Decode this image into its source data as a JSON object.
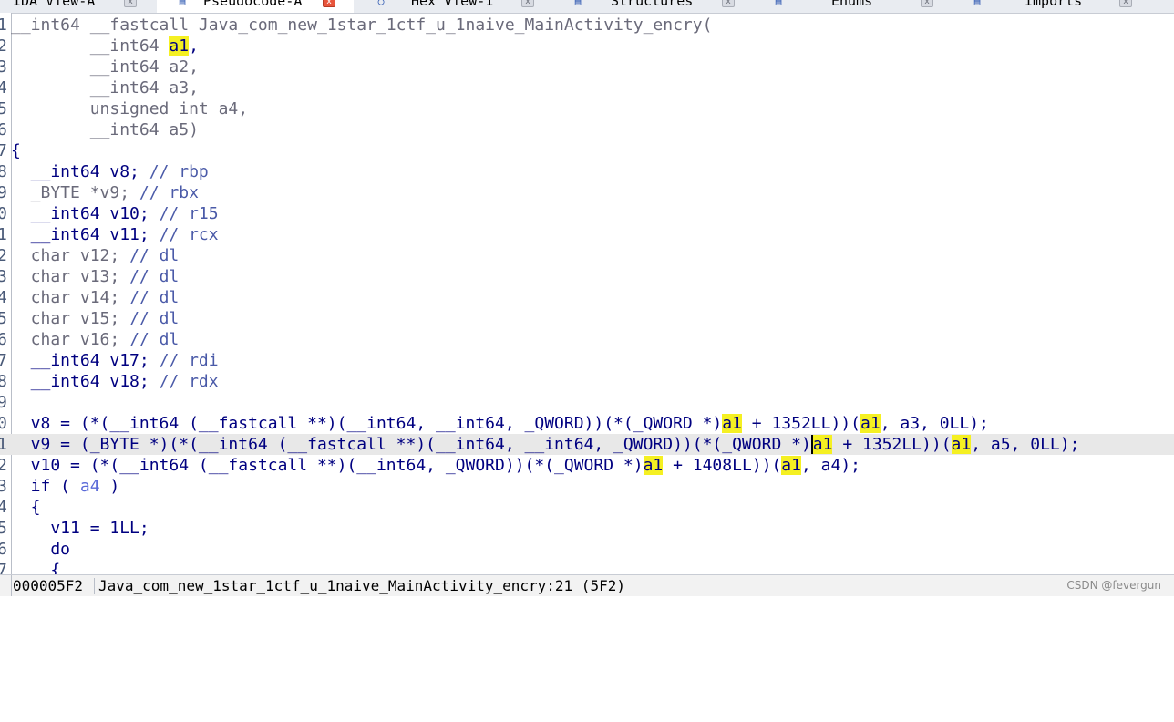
{
  "tabs": [
    {
      "label": "IDA View-A",
      "icon": "graph-icon",
      "close": "x",
      "active": false
    },
    {
      "label": "Pseudocode-A",
      "icon": "document-icon",
      "close": "x",
      "active": true
    },
    {
      "label": "Hex View-1",
      "icon": "hex-icon",
      "close": "x",
      "active": false
    },
    {
      "label": "Structures",
      "icon": "struct-icon",
      "close": "x",
      "active": false
    },
    {
      "label": "Enums",
      "icon": "enum-icon",
      "close": "x",
      "active": false
    },
    {
      "label": "Imports",
      "icon": "import-icon",
      "close": "x",
      "active": false
    }
  ],
  "code": {
    "highlight_color": "#f5f022",
    "current_line_color": "#e8e8e8",
    "lines": [
      {
        "n": "1",
        "text": "__int64 __fastcall Java_com_new_1star_1ctf_u_1naive_MainActivity_encry("
      },
      {
        "n": "2",
        "text": "        __int64 a1,"
      },
      {
        "n": "3",
        "text": "        __int64 a2,"
      },
      {
        "n": "4",
        "text": "        __int64 a3,"
      },
      {
        "n": "5",
        "text": "        unsigned int a4,"
      },
      {
        "n": "6",
        "text": "        __int64 a5)"
      },
      {
        "n": "7",
        "text": "{"
      },
      {
        "n": "8",
        "text": "  __int64 v8; // rbp"
      },
      {
        "n": "9",
        "text": "  _BYTE *v9; // rbx"
      },
      {
        "n": "0",
        "text": "  __int64 v10; // r15"
      },
      {
        "n": "1",
        "text": "  __int64 v11; // rcx"
      },
      {
        "n": "2",
        "text": "  char v12; // dl"
      },
      {
        "n": "3",
        "text": "  char v13; // dl"
      },
      {
        "n": "4",
        "text": "  char v14; // dl"
      },
      {
        "n": "5",
        "text": "  char v15; // dl"
      },
      {
        "n": "6",
        "text": "  char v16; // dl"
      },
      {
        "n": "7",
        "text": "  __int64 v17; // rdi"
      },
      {
        "n": "8",
        "text": "  __int64 v18; // rdx"
      },
      {
        "n": "9",
        "text": ""
      },
      {
        "n": "0",
        "text": "  v8 = (*(__int64 (__fastcall **)(__int64, __int64, _QWORD))(*(_QWORD *)a1 + 1352LL))(a1, a3, 0LL);"
      },
      {
        "n": "1",
        "text": "  v9 = (_BYTE *)(*(__int64 (__fastcall **)(__int64, __int64, _QWORD))(*(_QWORD *)a1 + 1352LL))(a1, a5, 0LL);"
      },
      {
        "n": "2",
        "text": "  v10 = (*(__int64 (__fastcall **)(__int64, _QWORD))(*(_QWORD *)a1 + 1408LL))(a1, a4);"
      },
      {
        "n": "3",
        "text": "  if ( a4 )"
      },
      {
        "n": "4",
        "text": "  {"
      },
      {
        "n": "5",
        "text": "    v11 = 1LL;"
      },
      {
        "n": "6",
        "text": "    do"
      },
      {
        "n": "7",
        "text": "    {"
      }
    ]
  },
  "status": {
    "address": "000005F2",
    "location": "Java_com_new_1star_1ctf_u_1naive_MainActivity_encry:21 (5F2)",
    "watermark": "CSDN @fevergun"
  }
}
